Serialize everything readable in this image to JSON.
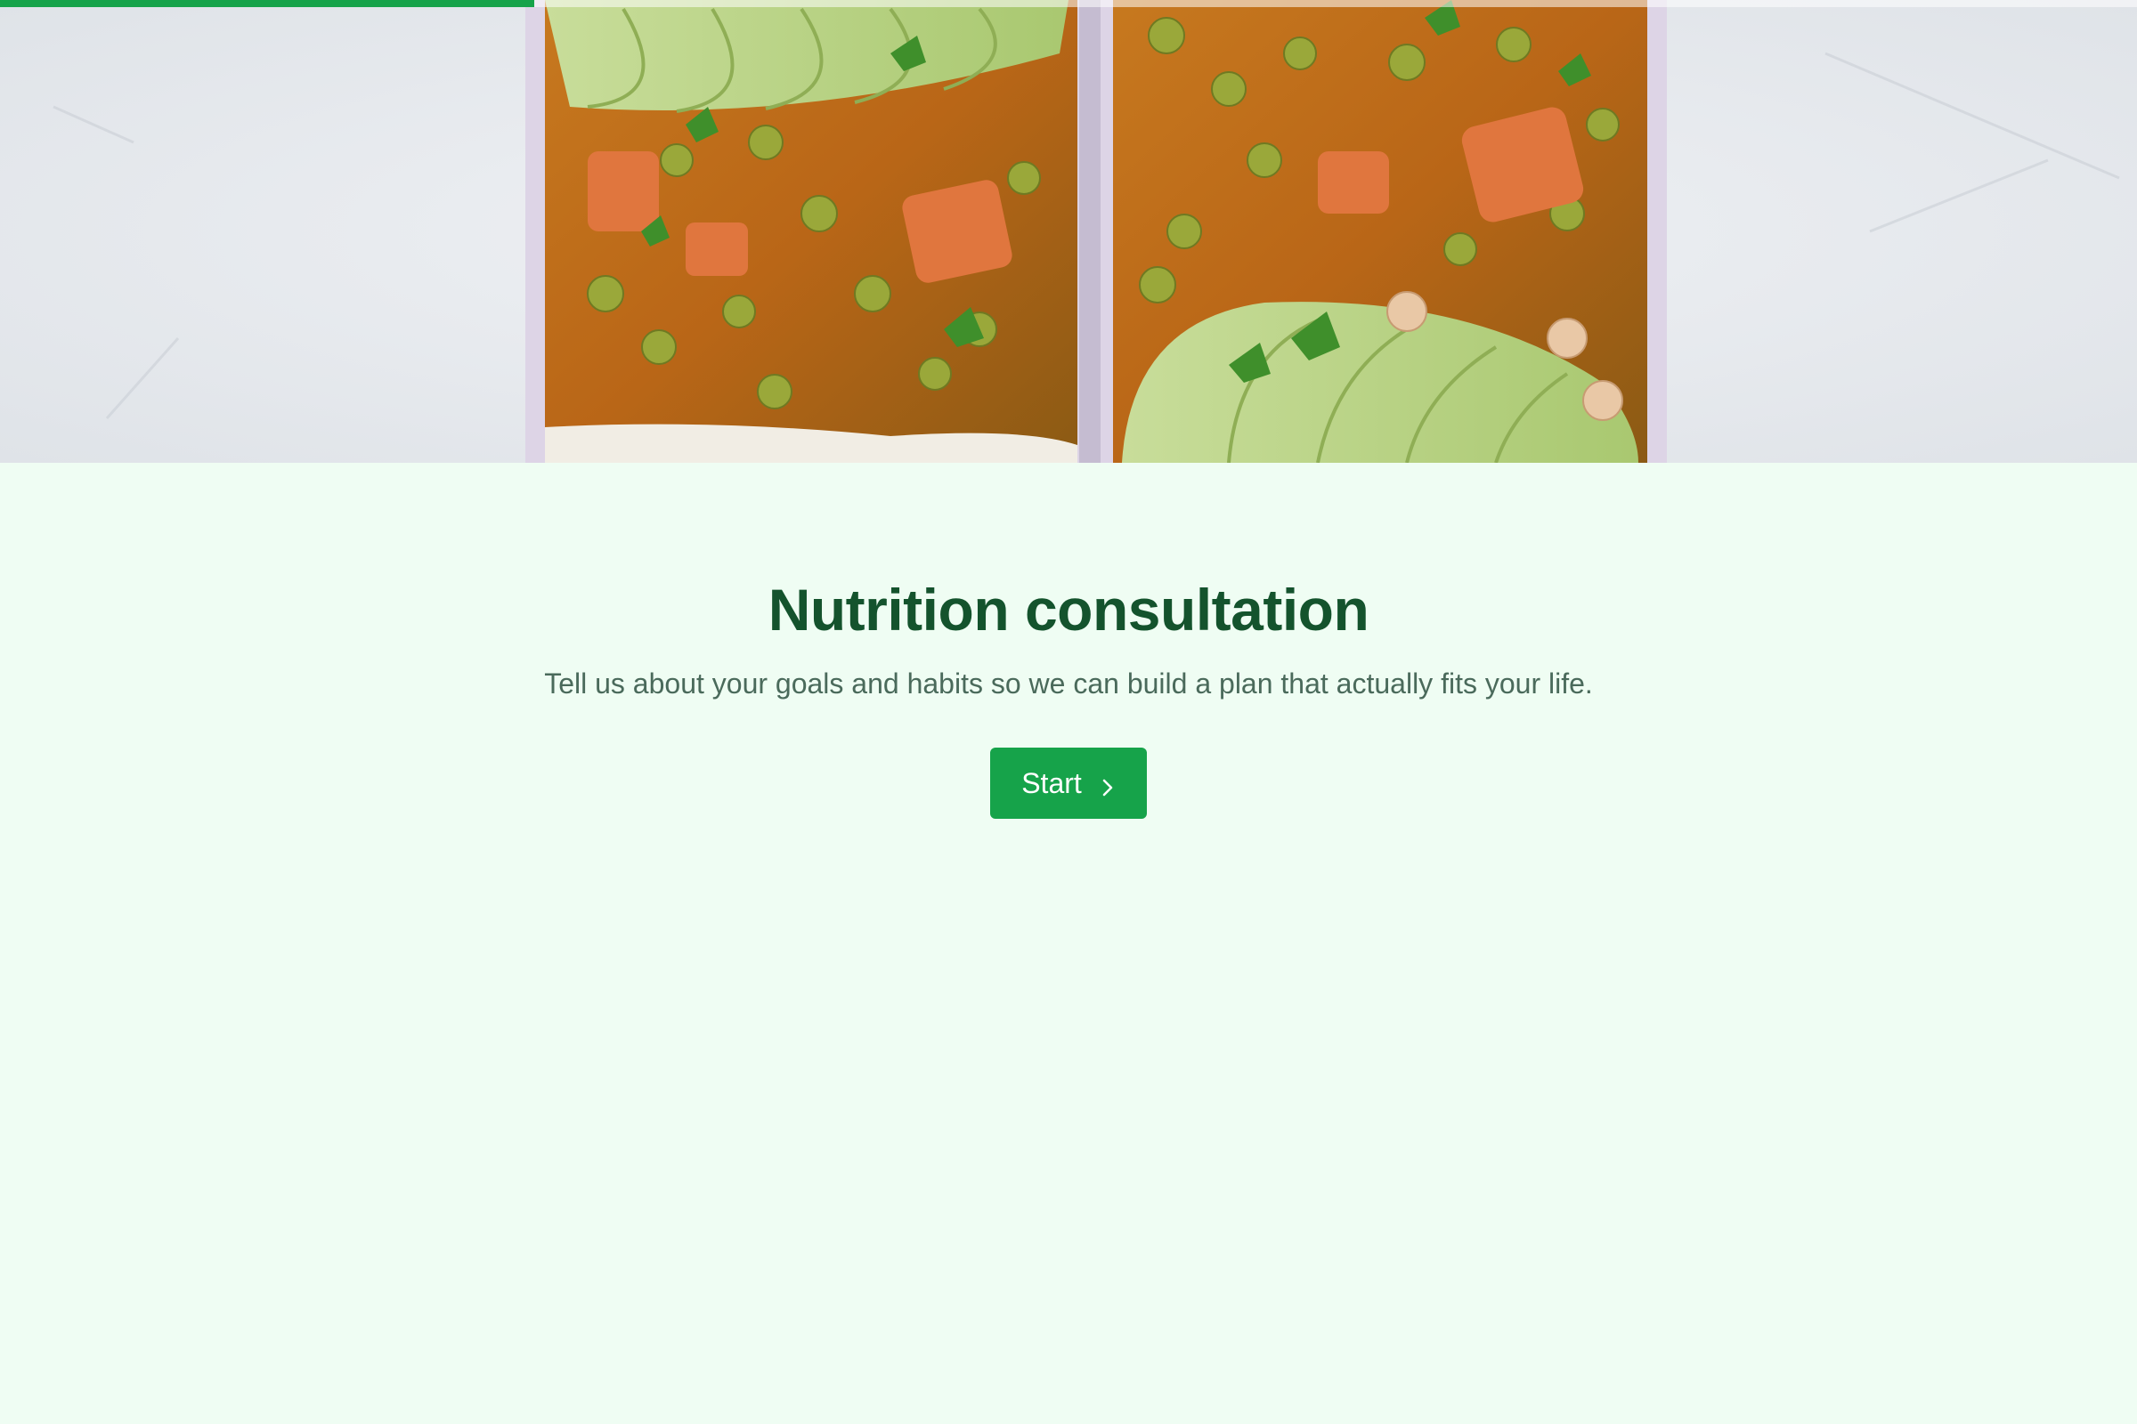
{
  "progress": {
    "fraction": 0.25,
    "color": "#16a34a"
  },
  "hero": {
    "image": "meal-prep-containers-image"
  },
  "main": {
    "title": "Nutrition consultation",
    "subtitle": "Tell us about your goals and habits so we can build a plan that actually fits your life.",
    "start_label": "Start",
    "start_icon": "chevron-right-icon"
  },
  "colors": {
    "background": "#effdf3",
    "title": "#14532d",
    "subtitle": "#4a6a5b",
    "accent": "#16a34a"
  }
}
